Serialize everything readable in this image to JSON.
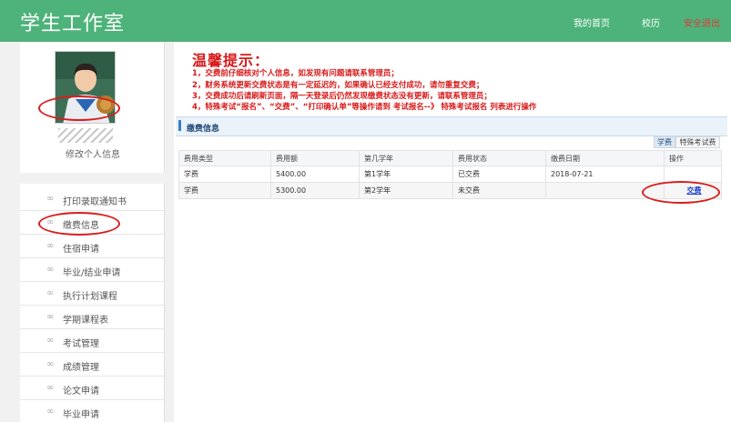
{
  "header": {
    "app_title": "学生工作室",
    "nav": [
      "我的首页",
      "校历",
      "安全退出"
    ],
    "accent_color": "#4db37a",
    "logout_color": "#e03b3b"
  },
  "profile": {
    "edit_label": "修改个人信息",
    "avatar_icon": "student-photo"
  },
  "sidebar": {
    "items": [
      {
        "label": "打印录取通知书",
        "icon": "∞"
      },
      {
        "label": "缴费信息",
        "icon": "∞"
      },
      {
        "label": "住宿申请",
        "icon": "∞"
      },
      {
        "label": "毕业/结业申请",
        "icon": "∞"
      },
      {
        "label": "执行计划课程",
        "icon": "∞"
      },
      {
        "label": "学期课程表",
        "icon": "∞"
      },
      {
        "label": "考试管理",
        "icon": "∞"
      },
      {
        "label": "成绩管理",
        "icon": "∞"
      },
      {
        "label": "论文申请",
        "icon": "∞"
      },
      {
        "label": "毕业申请",
        "icon": "∞"
      }
    ]
  },
  "notice": {
    "title": "温馨提示：",
    "lines": [
      "1，交费前仔细核对个人信息，如发现有问题请联系管理员；",
      "2，财务系统更新交费状态是有一定延迟的，如果确认已经支付成功，请勿重复交费；",
      "3，交费成功后请刷新页面，隔一天登录后仍然发现缴费状态没有更新，请联系管理员；",
      "4，特殊考试“报名”、“交费”、“打印确认单”等操作请到 考试报名--》 特殊考试报名 列表进行操作"
    ],
    "color": "#d71818"
  },
  "fees_panel": {
    "title": "缴费信息",
    "tabs": [
      "学费",
      "特殊考试费"
    ],
    "columns": [
      "费用类型",
      "费用额",
      "第几学年",
      "费用状态",
      "缴费日期",
      "操作"
    ],
    "rows": [
      {
        "type": "学费",
        "amount": "5400.00",
        "year": "第1学年",
        "status": "已交费",
        "date": "2018-07-21",
        "action": ""
      },
      {
        "type": "学费",
        "amount": "5300.00",
        "year": "第2学年",
        "status": "未交费",
        "date": "",
        "action": "交费"
      }
    ]
  },
  "highlight_color": "#d81e1e"
}
